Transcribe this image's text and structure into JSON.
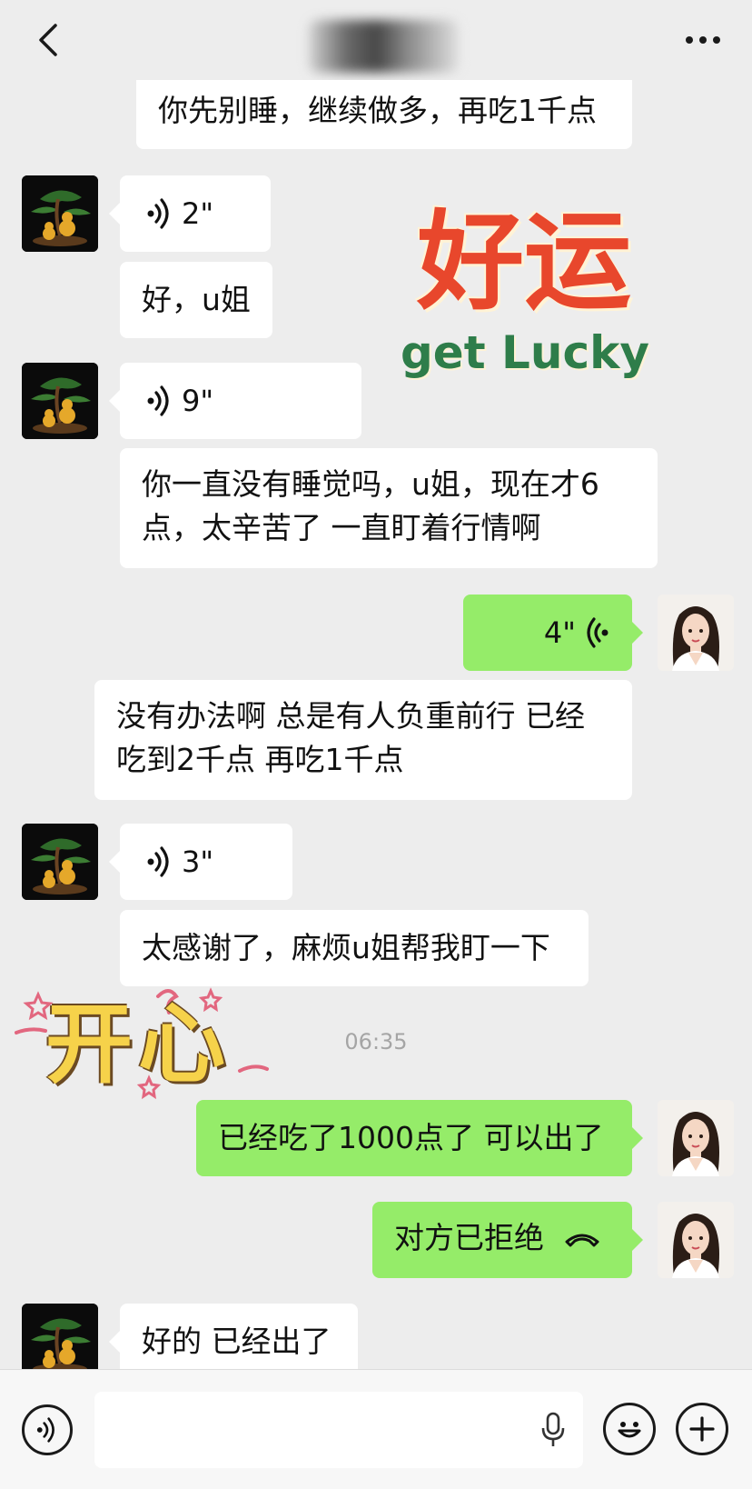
{
  "header": {
    "back_icon": "chevron-left-icon",
    "more_icon": "more-dots-icon"
  },
  "messages": [
    {
      "id": "m1",
      "side": "left",
      "type": "text",
      "text": "你先别睡，继续做多，再吃1千点"
    },
    {
      "id": "m2",
      "side": "left",
      "type": "voice",
      "duration": "2\""
    },
    {
      "id": "m3",
      "side": "left",
      "type": "text",
      "text": "好，u姐"
    },
    {
      "id": "m4",
      "side": "left",
      "type": "voice",
      "duration": "9\""
    },
    {
      "id": "m5",
      "side": "left",
      "type": "text",
      "line1": "你一直没有睡觉吗，u姐，现在才6",
      "line2": "点，太辛苦了 一直盯着行情啊"
    },
    {
      "id": "m6",
      "side": "right",
      "type": "voice",
      "duration": "4\""
    },
    {
      "id": "m7",
      "side": "left",
      "type": "text",
      "line1": "没有办法啊 总是有人负重前行 已经",
      "line2": "吃到2千点 再吃1千点"
    },
    {
      "id": "m8",
      "side": "left",
      "type": "voice",
      "duration": "3\""
    },
    {
      "id": "m9",
      "side": "left",
      "type": "text",
      "text": "太感谢了，麻烦u姐帮我盯一下"
    },
    {
      "id": "m10",
      "side": "right",
      "type": "text",
      "text": "已经吃了1000点了 可以出了"
    },
    {
      "id": "m11",
      "side": "right",
      "type": "call",
      "text": "对方已拒绝"
    },
    {
      "id": "m12",
      "side": "left",
      "type": "text",
      "text": "好的 已经出了"
    }
  ],
  "timestamp": "06:35",
  "stickers": {
    "lucky_cn": "好运",
    "lucky_en": "get Lucky",
    "happy_cn": "开心"
  },
  "colors": {
    "background": "#ededed",
    "bubble_incoming": "#ffffff",
    "bubble_outgoing": "#95ec69",
    "sticker_red": "#e8472c",
    "sticker_green": "#2e7d4a",
    "sticker_yellow": "#f6d24a"
  },
  "bottom": {
    "voice_toggle_icon": "voice-wave-icon",
    "mic_icon": "microphone-icon",
    "emoji_icon": "smiley-icon",
    "add_icon": "plus-icon"
  }
}
